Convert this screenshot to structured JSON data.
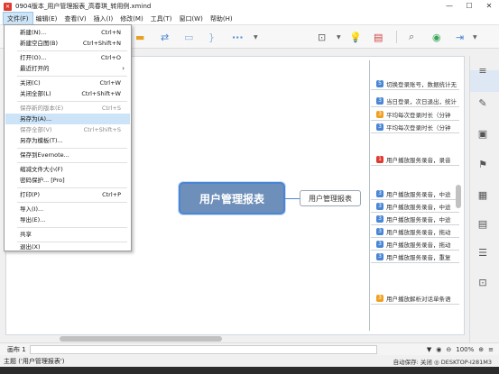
{
  "window": {
    "title": "0904版本_用户管理报表_高春琪_转用例.xmind",
    "app_icon": "xmind-logo",
    "minimize": "—",
    "maximize": "☐",
    "close": "✕"
  },
  "menubar": {
    "items": [
      "文件(F)",
      "编辑(E)",
      "查看(V)",
      "插入(I)",
      "修改(M)",
      "工具(T)",
      "窗口(W)",
      "帮助(H)"
    ]
  },
  "file_menu": {
    "items": [
      {
        "label": "新建(N)...",
        "shortcut": "Ctrl+N"
      },
      {
        "label": "新建空白图(B)",
        "shortcut": "Ctrl+Shift+N"
      },
      {
        "label": "打开(O)...",
        "shortcut": "Ctrl+O"
      },
      {
        "label": "最近打开的",
        "shortcut": ""
      },
      {
        "label": "关闭(C)",
        "shortcut": "Ctrl+W"
      },
      {
        "label": "关闭全部(L)",
        "shortcut": "Ctrl+Shift+W"
      },
      {
        "label": "保存新的版本(E)",
        "shortcut": "Ctrl+S"
      },
      {
        "label": "另存为(A)...",
        "shortcut": ""
      },
      {
        "label": "保存全部(V)",
        "shortcut": "Ctrl+Shift+S"
      },
      {
        "label": "另存为模板(T)...",
        "shortcut": ""
      },
      {
        "label": "保存到Evernote...",
        "shortcut": ""
      },
      {
        "label": "缩减文件大小(F)",
        "shortcut": ""
      },
      {
        "label": "密码保护... [Pro]",
        "shortcut": ""
      },
      {
        "label": "打印(P)",
        "shortcut": "Ctrl+P"
      },
      {
        "label": "导入(I)...",
        "shortcut": ""
      },
      {
        "label": "导出(E)...",
        "shortcut": ""
      },
      {
        "label": "共享",
        "shortcut": ""
      },
      {
        "label": "退出(X)",
        "shortcut": ""
      }
    ],
    "submenu_arrow": "›"
  },
  "toolbar": {
    "icons": [
      "topic-icon",
      "relationship-icon",
      "boundary-icon",
      "summary-icon",
      "more-icon",
      "presentation-icon",
      "idea-icon",
      "outliner-icon",
      "search-icon",
      "share-icon",
      "export-icon"
    ],
    "more_label": "···"
  },
  "mindmap": {
    "central_topic": "用户管理报表",
    "subtopic": "用户管理报表",
    "branches": [
      {
        "num": "5",
        "color": "#4a86d4",
        "text": "切换登录账号，数据统计无"
      },
      {
        "num": "3",
        "color": "#4a86d4",
        "text": "当日登录，次日退出，统计"
      },
      {
        "num": "3",
        "color": "#f0a020",
        "text": "平均每次登录时长（分钟"
      },
      {
        "num": "3",
        "color": "#4a86d4",
        "text": "平均每次登录时长（分钟"
      },
      {
        "num": "1",
        "color": "#e03a2f",
        "text": "用户播放服务录音，录音"
      },
      {
        "num": "3",
        "color": "#4a86d4",
        "text": "用户播放服务录音，中途"
      },
      {
        "num": "3",
        "color": "#4a86d4",
        "text": "用户播放服务录音，中途"
      },
      {
        "num": "3",
        "color": "#4a86d4",
        "text": "用户播放服务录音，中途"
      },
      {
        "num": "3",
        "color": "#4a86d4",
        "text": "用户播放服务录音，拖动"
      },
      {
        "num": "3",
        "color": "#4a86d4",
        "text": "用户播放服务录音，拖动"
      },
      {
        "num": "3",
        "color": "#4a86d4",
        "text": "用户播放服务录音，重复"
      },
      {
        "num": "3",
        "color": "#f0a020",
        "text": "用户播放解析对话单条语"
      }
    ]
  },
  "right_panel": {
    "icons": [
      "outline-icon",
      "format-icon",
      "image-icon",
      "marker-icon",
      "notes-icon",
      "comments-icon",
      "task-icon",
      "attachment-icon"
    ]
  },
  "sheetbar": {
    "tab_label": "画布 1",
    "zoom": "100%",
    "filter_icon": "filter-icon",
    "eye_icon": "eye-icon"
  },
  "statusbar": {
    "left": "主题 ('用户管理报表')",
    "right": "自动保存: 关闭   ◎ DESKTOP-I281M3"
  }
}
